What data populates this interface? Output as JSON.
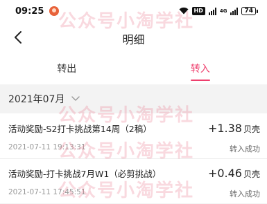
{
  "status_bar": {
    "time": "09:25",
    "hd_label": "HD",
    "network_label": "4G",
    "battery": "74"
  },
  "nav": {
    "title": "明细"
  },
  "tabs": [
    {
      "label": "转出",
      "active": false
    },
    {
      "label": "转入",
      "active": true
    }
  ],
  "accent_color": "#ee3f6d",
  "month_selector": {
    "label": "2021年07月"
  },
  "records": [
    {
      "title": "活动奖励-S2打卡挑战第14周（2稿）",
      "amount": "+1.38",
      "unit": "贝壳",
      "time": "2021-07-11 19:13:31",
      "status": "转入成功"
    },
    {
      "title": "活动奖励-打卡挑战7月W1（必剪挑战）",
      "amount": "+0.46",
      "unit": "贝壳",
      "time": "2021-07-11 17:45:51",
      "status": "转入成功"
    }
  ],
  "watermark": "公众号小淘学社"
}
